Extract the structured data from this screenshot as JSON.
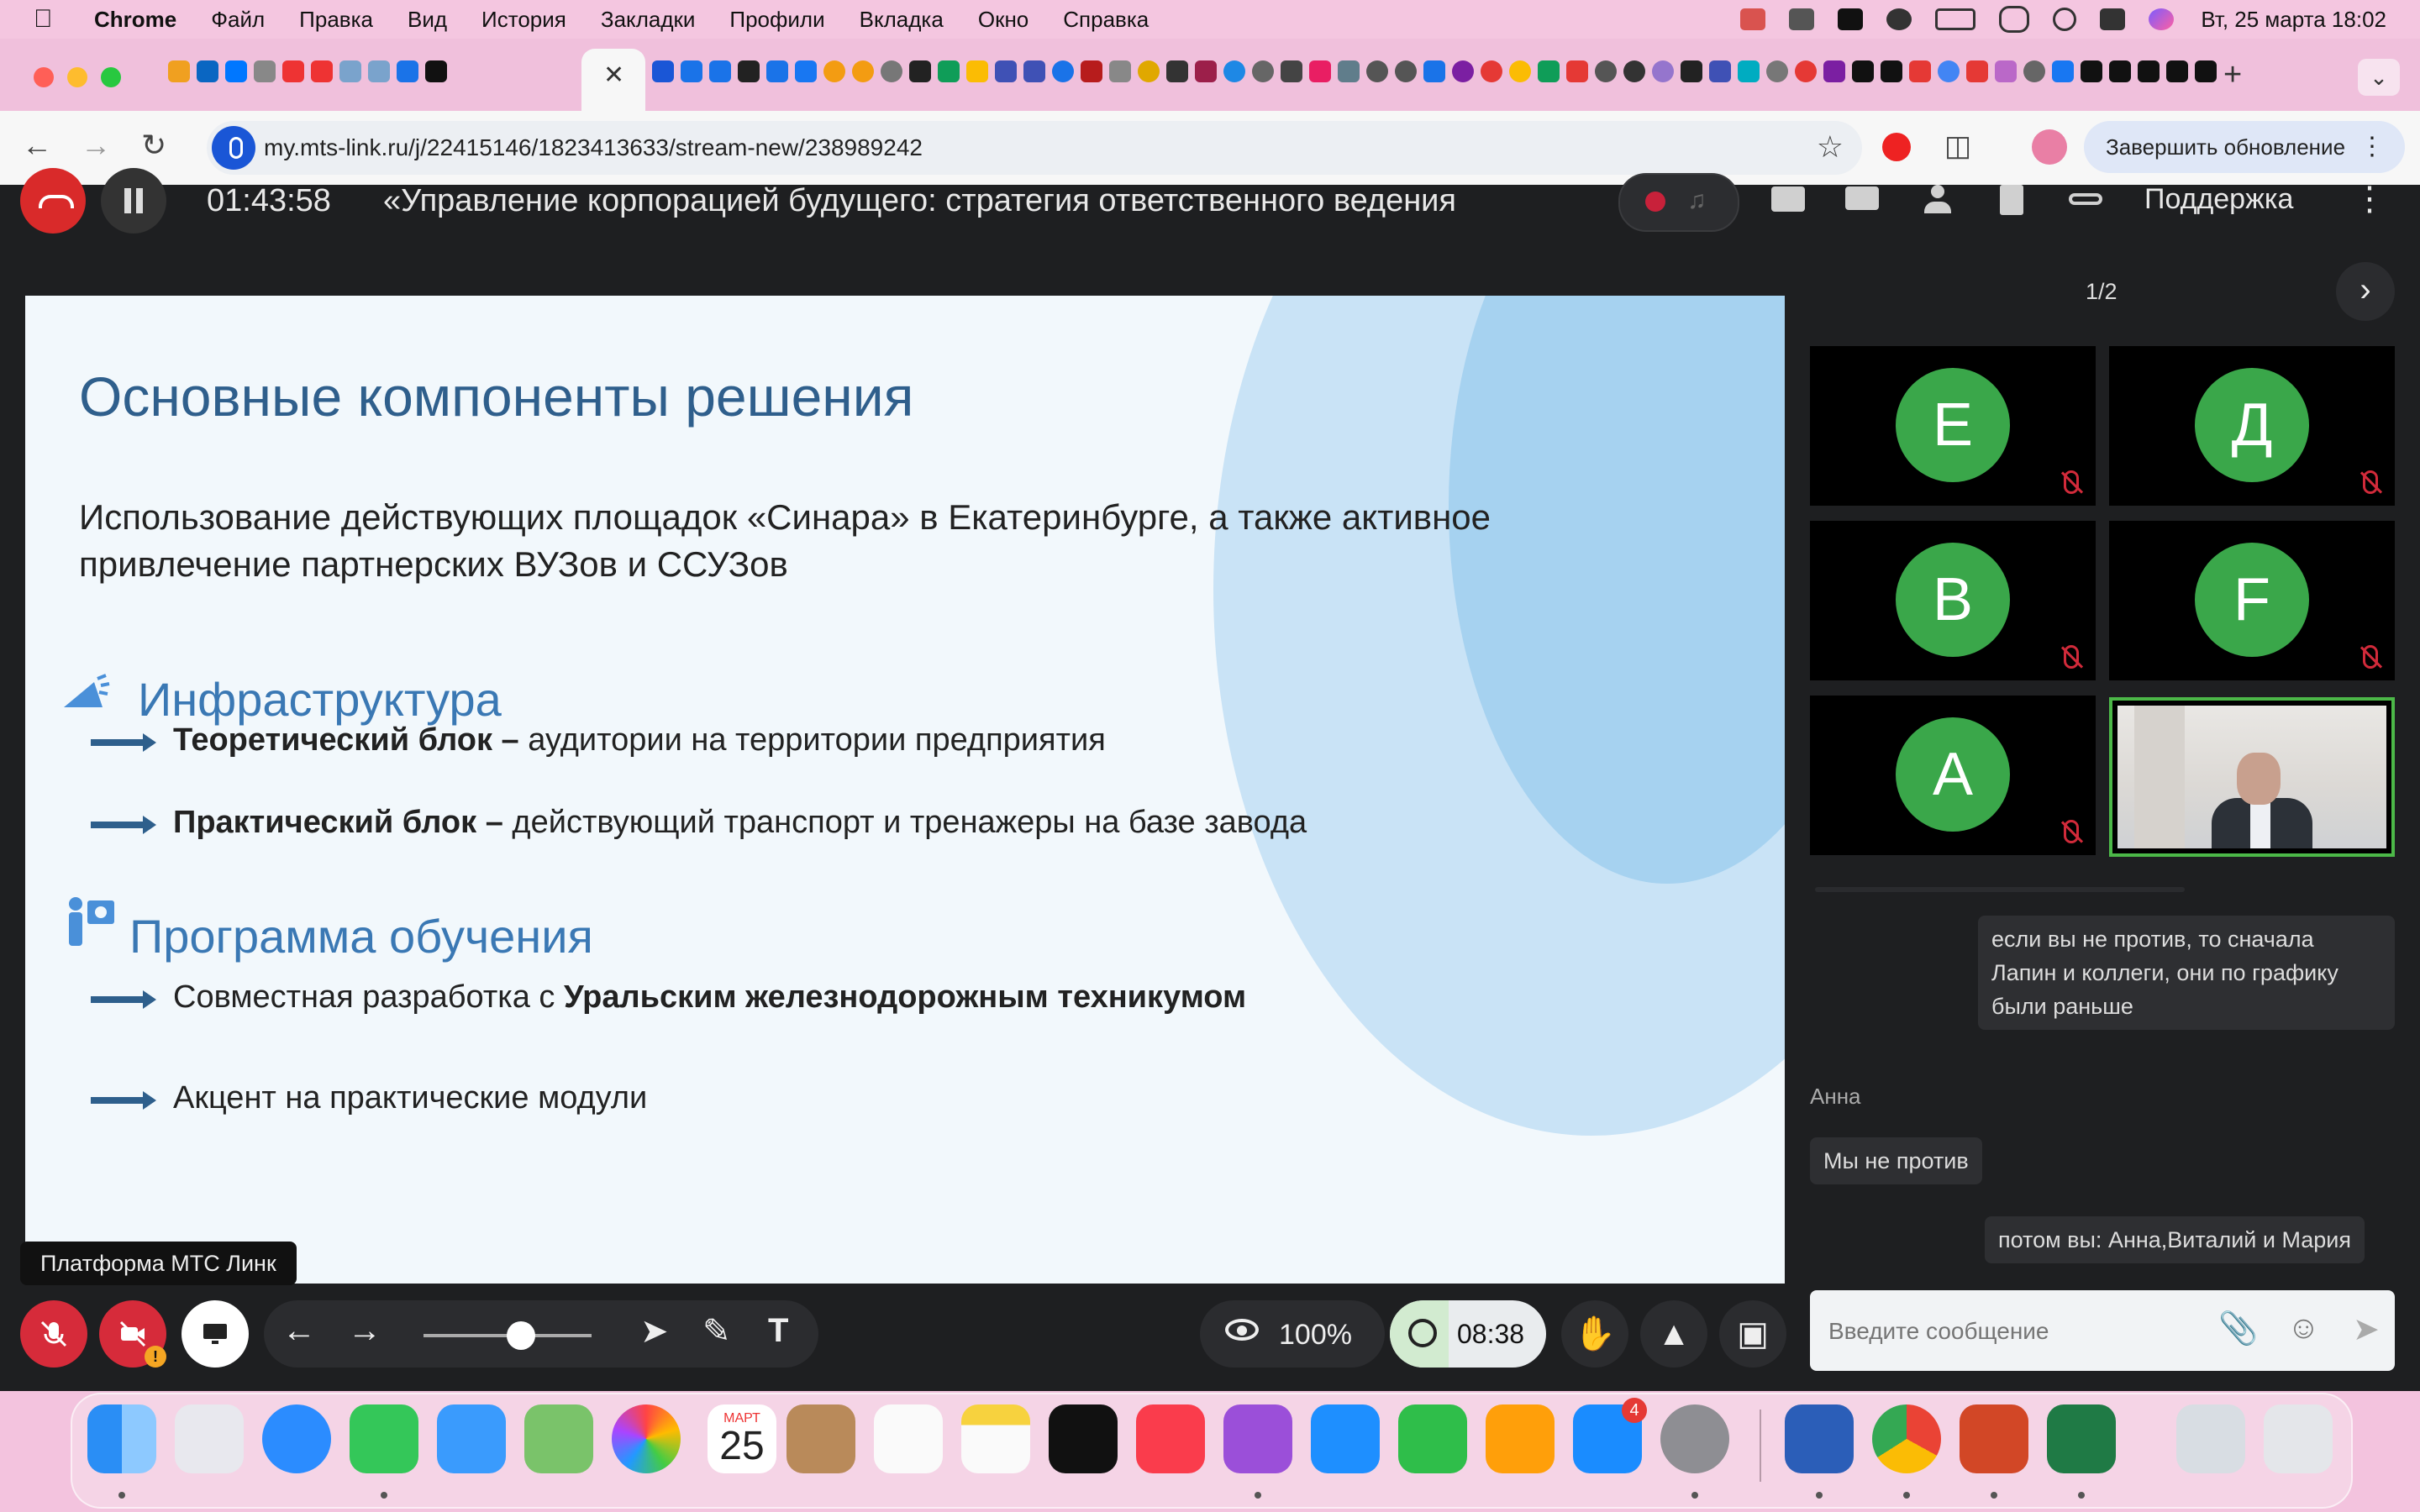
{
  "menubar": {
    "app": "Chrome",
    "items": [
      "Файл",
      "Правка",
      "Вид",
      "История",
      "Закладки",
      "Профили",
      "Вкладка",
      "Окно",
      "Справка"
    ],
    "clock": "Вт, 25 марта  18:02"
  },
  "browser": {
    "url": "my.mts-link.ru/j/22415146/1823413633/stream-new/238989242",
    "update_button": "Завершить обновление",
    "active_tab_close": "✕",
    "new_tab": "+"
  },
  "webinar": {
    "elapsed": "01:43:58",
    "title": "«Управление корпорацией будущего: стратегия ответственного ведения",
    "support": "Поддержка",
    "pager": "1/2",
    "platform_label": "Платформа МТС Линк",
    "zoom": "100%",
    "countdown": "08:38"
  },
  "slide": {
    "title": "Основные компоненты решения",
    "lead": "Использование действующих площадок «Синара» в Екатеринбурге, а также активное привлечение партнерских ВУЗов и ССУЗов",
    "section1": "Инфраструктура",
    "b1_bold": "Теоретический блок –",
    "b1_rest": " аудитории на территории предприятия",
    "b2_bold": "Практический блок –",
    "b2_rest": " действующий транспорт и тренажеры на базе завода",
    "section2": "Программа обучения",
    "b3_rest": "Совместная разработка с ",
    "b3_bold": "Уральским железнодорожным техникумом",
    "b4": "Акцент на практические модули"
  },
  "participants": [
    {
      "initial": "Е",
      "muted": true
    },
    {
      "initial": "Д",
      "muted": true
    },
    {
      "initial": "В",
      "muted": true
    },
    {
      "initial": "F",
      "muted": true
    },
    {
      "initial": "А",
      "muted": true
    }
  ],
  "chat": {
    "msg1": "если вы не против, то сначала Лапин и коллеги, они по графику были раньше",
    "author": "Анна",
    "msg2": "Мы не против",
    "msg3": "потом вы: Анна,Виталий и Мария",
    "placeholder": "Введите сообщение"
  },
  "dock": {
    "calendar_month": "МАРТ",
    "calendar_day": "25",
    "appstore_badge": "4"
  },
  "colors": {
    "slide_title": "#2f5f8c",
    "section": "#3a78b4",
    "avatar": "#3aa74a",
    "danger": "#d62b3a",
    "active_speaker": "#4cb848"
  }
}
